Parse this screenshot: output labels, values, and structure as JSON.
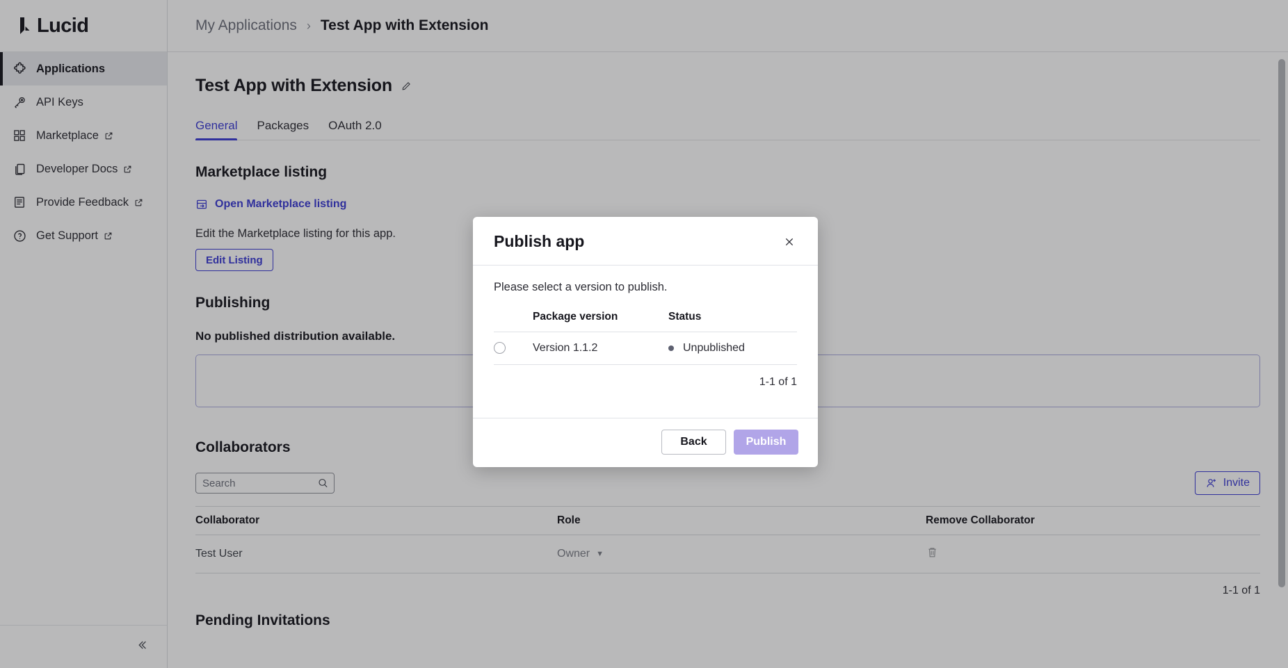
{
  "brand": {
    "name": "Lucid",
    "logo_icon": "lucid-logo-icon"
  },
  "sidebar": {
    "items": [
      {
        "label": "Applications",
        "icon": "puzzle-piece-icon",
        "external": false,
        "active": true
      },
      {
        "label": "API Keys",
        "icon": "keys-icon",
        "external": false,
        "active": false
      },
      {
        "label": "Marketplace",
        "icon": "grid-icon",
        "external": true,
        "active": false
      },
      {
        "label": "Developer Docs",
        "icon": "documents-icon",
        "external": true,
        "active": false
      },
      {
        "label": "Provide Feedback",
        "icon": "form-icon",
        "external": true,
        "active": false
      },
      {
        "label": "Get Support",
        "icon": "question-circle-icon",
        "external": true,
        "active": false
      }
    ],
    "collapse_icon": "double-chevron-left-icon"
  },
  "breadcrumb": {
    "parent": "My Applications",
    "separator": "›",
    "current": "Test App with Extension"
  },
  "page": {
    "title": "Test App with Extension",
    "edit_title_icon": "pencil-icon"
  },
  "tabs": [
    {
      "label": "General",
      "active": true
    },
    {
      "label": "Packages",
      "active": false
    },
    {
      "label": "OAuth 2.0",
      "active": false
    }
  ],
  "marketplace_listing": {
    "heading": "Marketplace listing",
    "open_link_label": "Open Marketplace listing",
    "open_link_icon": "open-in-panel-icon",
    "description": "Edit the Marketplace listing for this app.",
    "edit_button_label": "Edit Listing"
  },
  "publishing": {
    "heading": "Publishing",
    "empty_message": "No published distribution available."
  },
  "collaborators": {
    "heading": "Collaborators",
    "search": {
      "placeholder": "Search",
      "value": "",
      "icon": "search-icon"
    },
    "invite_button_label": "Invite",
    "invite_button_icon": "user-plus-icon",
    "columns": [
      "Collaborator",
      "Role",
      "Remove Collaborator"
    ],
    "rows": [
      {
        "name": "Test User",
        "role": "Owner",
        "role_caret": "▼",
        "remove_icon": "trash-icon"
      }
    ],
    "pagination": "1-1 of 1"
  },
  "pending_invitations": {
    "heading": "Pending Invitations"
  },
  "modal": {
    "title": "Publish app",
    "close_icon": "close-icon",
    "instruction": "Please select a version to publish.",
    "columns": [
      "",
      "Package version",
      "Status"
    ],
    "rows": [
      {
        "selected": false,
        "version": "Version 1.1.2",
        "status": "Unpublished",
        "status_color": "#5d6070"
      }
    ],
    "pagination": "1-1 of 1",
    "back_button_label": "Back",
    "publish_button_label": "Publish",
    "publish_button_disabled": true
  },
  "colors": {
    "accent": "#3c3cd4",
    "publish_disabled": "#b1a5e8",
    "text_primary": "#16161d",
    "text_muted": "#6c6f7a",
    "border": "#d8dade",
    "overlay": "rgba(23,23,28,0.30)"
  }
}
